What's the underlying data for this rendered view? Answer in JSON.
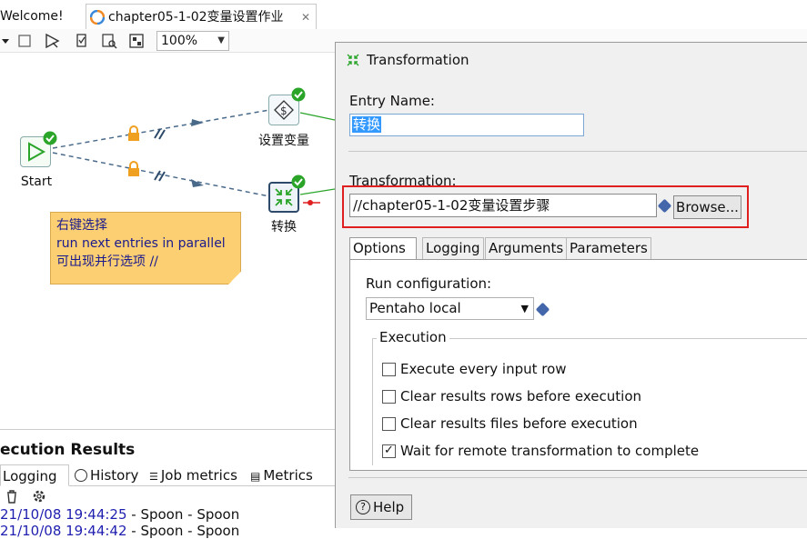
{
  "tabs": [
    {
      "label": "Welcome!",
      "active": false
    },
    {
      "label": "chapter05-1-02变量设置作业",
      "active": true
    }
  ],
  "toolbar": {
    "zoom": "100%"
  },
  "canvas": {
    "nodes": [
      {
        "id": "start",
        "label": "Start"
      },
      {
        "id": "set-variables",
        "label": "设置变量"
      },
      {
        "id": "transformation",
        "label": "转换"
      }
    ],
    "note_lines": [
      "右键选择",
      "run next entries in parallel",
      "可出现并行选项 //"
    ]
  },
  "execution_results": {
    "title": "ecution Results",
    "tabs": [
      "Logging",
      "History",
      "Job metrics",
      "Metrics"
    ],
    "log_lines": [
      {
        "timestamp": "21/10/08 19:44:25",
        "text": " - Spoon - Spoon"
      },
      {
        "timestamp": "21/10/08 19:44:42",
        "text": " - Spoon - Spoon"
      }
    ]
  },
  "dialog": {
    "title": "Transformation",
    "entry_name_label": "Entry Name:",
    "entry_name_value": "转换",
    "transformation_label": "Transformation:",
    "transformation_value": "//chapter05-1-02变量设置步骤",
    "browse_label": "Browse...",
    "tabs": [
      "Options",
      "Logging",
      "Arguments",
      "Parameters"
    ],
    "run_configuration_label": "Run configuration:",
    "run_configuration_value": "Pentaho local",
    "execution_group_label": "Execution",
    "checkboxes": [
      {
        "label": "Execute every input row",
        "checked": false
      },
      {
        "label": "Clear results rows before execution",
        "checked": false
      },
      {
        "label": "Clear results files before execution",
        "checked": false
      },
      {
        "label": "Wait for remote transformation to complete",
        "checked": true
      }
    ],
    "help_label": "Help"
  },
  "colors": {
    "highlight": "#e02020",
    "note": "#fccf73",
    "ok_badge": "#2aa52a",
    "link_blue": "#1f1fb0"
  }
}
